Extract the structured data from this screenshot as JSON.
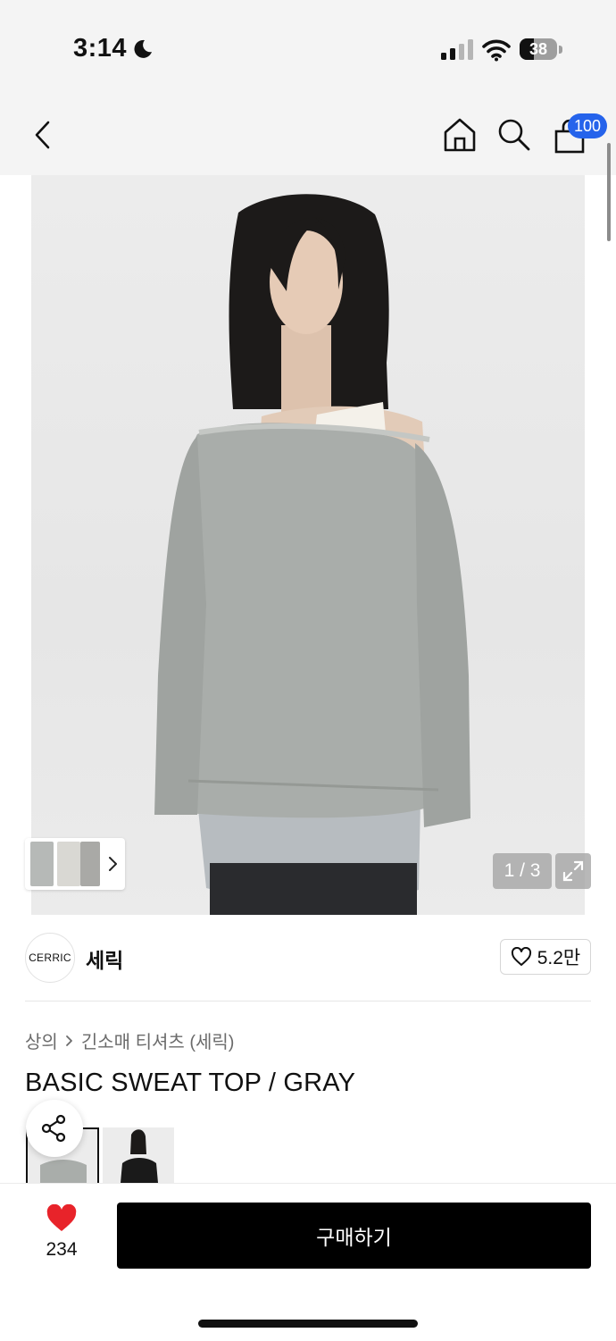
{
  "status": {
    "time": "3:14",
    "battery_level": "38",
    "battery_fraction": 0.38
  },
  "nav": {
    "back_icon": "chevron-left-icon",
    "home_icon": "home-icon",
    "search_icon": "search-icon",
    "cart_icon": "shopping-bag-icon",
    "cart_badge": "100"
  },
  "gallery": {
    "counter": "1 / 3"
  },
  "brand": {
    "logo_text": "CERRIC",
    "name": "세릭",
    "like_count": "5.2만"
  },
  "breadcrumb": {
    "category": "상의",
    "subcategory": "긴소매 티셔츠 (세릭)"
  },
  "product": {
    "title": "BASIC SWEAT TOP / GRAY"
  },
  "bottom": {
    "wish_count": "234",
    "buy_label": "구매하기"
  },
  "colors": {
    "accent": "#2563eb",
    "heart": "#e8232a"
  }
}
